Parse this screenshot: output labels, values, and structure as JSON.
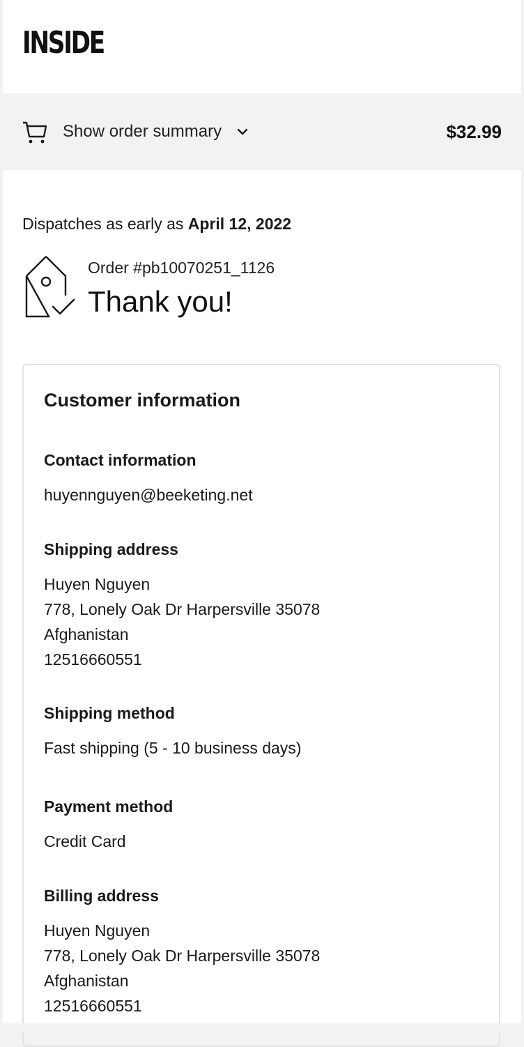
{
  "header": {
    "logo_text": "INSIDE"
  },
  "order_summary": {
    "toggle_label": "Show order summary",
    "total": "$32.99",
    "icons": [
      "cart-icon",
      "chevron-down-icon"
    ]
  },
  "dispatch": {
    "prefix": "Dispatches as early as ",
    "date": "April 12, 2022"
  },
  "confirmation": {
    "order_number": "Order #pb10070251_1126",
    "thank_you": "Thank you!",
    "icon": "tag-check-icon"
  },
  "customer_info": {
    "title": "Customer information",
    "contact": {
      "heading": "Contact information",
      "email": "huyennguyen@beeketing.net"
    },
    "shipping_address": {
      "heading": "Shipping address",
      "lines": [
        "Huyen Nguyen",
        "778, Lonely Oak Dr Harpersville 35078",
        "Afghanistan",
        "12516660551"
      ]
    },
    "shipping_method": {
      "heading": "Shipping method",
      "value": "Fast shipping (5 - 10 business days)"
    },
    "payment_method": {
      "heading": "Payment method",
      "value": "Credit Card"
    },
    "billing_address": {
      "heading": "Billing address",
      "lines": [
        "Huyen Nguyen",
        "778, Lonely Oak Dr Harpersville 35078",
        "Afghanistan",
        "12516660551"
      ]
    }
  }
}
